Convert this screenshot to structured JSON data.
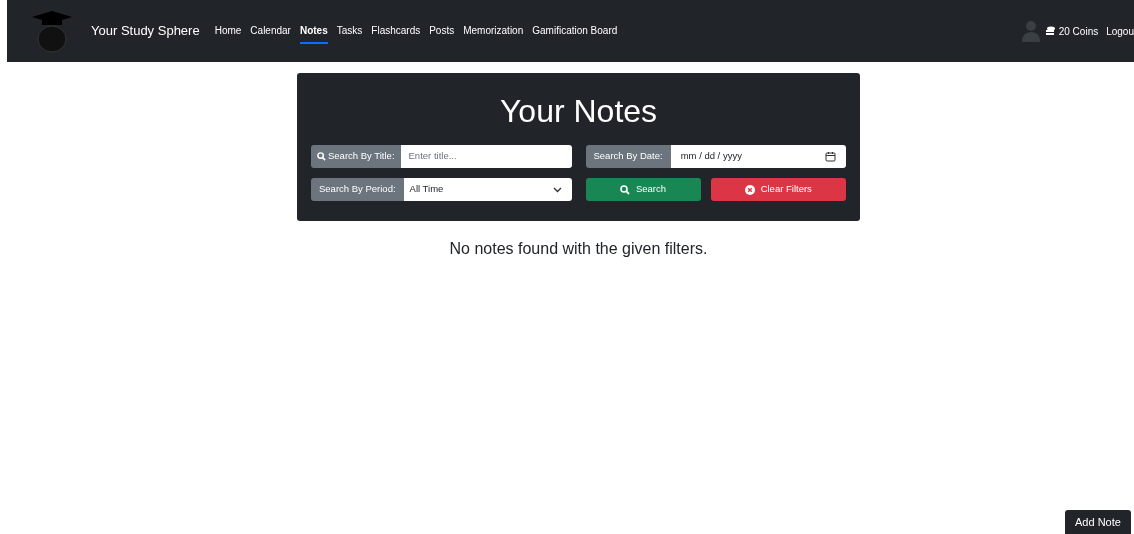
{
  "navbar": {
    "brand": "Your Study Sphere",
    "items": [
      {
        "label": "Home",
        "selected": false
      },
      {
        "label": "Calendar",
        "selected": false
      },
      {
        "label": "Notes",
        "selected": true
      },
      {
        "label": "Tasks",
        "selected": false
      },
      {
        "label": "Flashcards",
        "selected": false
      },
      {
        "label": "Posts",
        "selected": false
      },
      {
        "label": "Memorization",
        "selected": false
      },
      {
        "label": "Gamification Board",
        "selected": false
      }
    ],
    "coins": "20 Coins",
    "logout": "Logou"
  },
  "filters": {
    "title": "Your Notes",
    "title_label": "Search By Title:",
    "title_placeholder": "Enter title...",
    "date_label": "Search By Date:",
    "date_placeholder": "mm / dd / yyyy",
    "period_label": "Search By Period:",
    "period_value": "All Time",
    "search_button": "Search",
    "clear_button": "Clear Filters"
  },
  "empty_message": "No notes found with the given filters.",
  "add_button": "Add Note"
}
